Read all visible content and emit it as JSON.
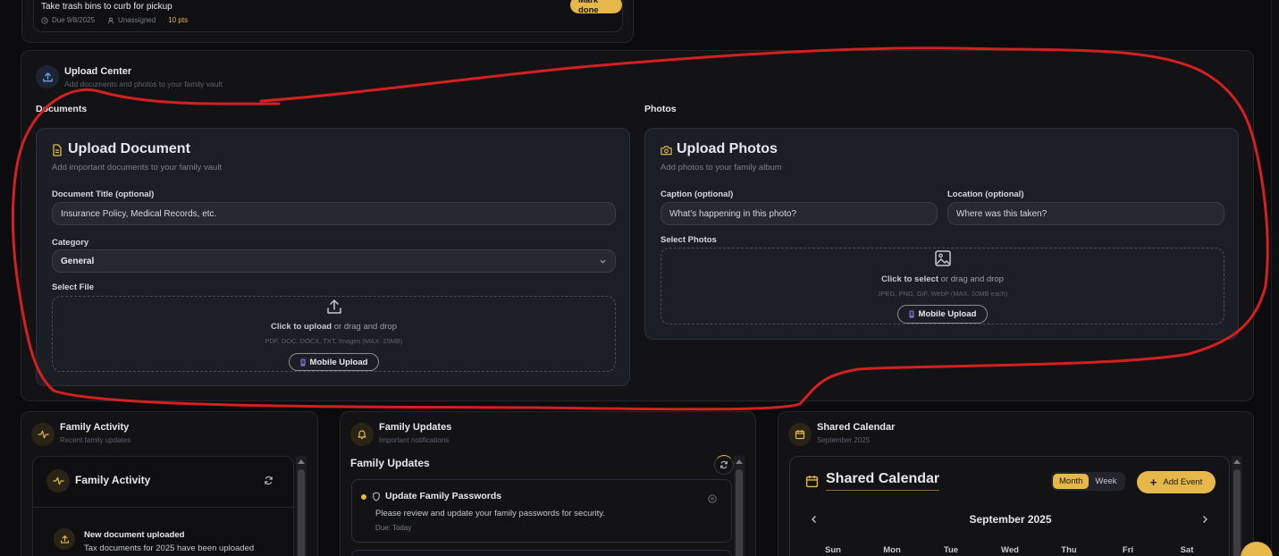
{
  "chores_card": {
    "chore_title": "Take trash bins to curb for pickup",
    "due": "Due 9/8/2025",
    "assignee": "Unassigned",
    "points": "10 pts",
    "mark_done_label": "Mark done"
  },
  "upload_center": {
    "title": "Upload Center",
    "subtitle": "Add documents and photos to your family vault",
    "documents": {
      "section_label": "Documents",
      "card_title": "Upload Document",
      "card_subtitle": "Add important documents to your family vault",
      "title_label": "Document Title (optional)",
      "title_placeholder": "Insurance Policy, Medical Records, etc.",
      "category_label": "Category",
      "category_value": "General",
      "file_label": "Select File",
      "drop_primary": "Click to upload",
      "drop_secondary": " or drag and drop",
      "drop_hint": "PDF, DOC, DOCX, TXT, Images (MAX. 25MB)",
      "mobile_upload_label": "Mobile Upload"
    },
    "photos": {
      "section_label": "Photos",
      "card_title": "Upload Photos",
      "card_subtitle": "Add photos to your family album",
      "caption_label": "Caption (optional)",
      "caption_placeholder": "What's happening in this photo?",
      "location_label": "Location (optional)",
      "location_placeholder": "Where was this taken?",
      "select_label": "Select Photos",
      "drop_primary": "Click to select",
      "drop_secondary": " or drag and drop",
      "drop_hint": "JPEG, PNG, GIF, WebP (MAX. 10MB each)",
      "mobile_upload_label": "Mobile Upload"
    }
  },
  "family_activity": {
    "title": "Family Activity",
    "subtitle": "Recent family updates",
    "inner_title": "Family Activity",
    "item_title": "New document uploaded",
    "item_desc": "Tax documents for 2025 have been uploaded"
  },
  "family_updates": {
    "title": "Family Updates",
    "subtitle": "Important notifications",
    "inner_title": "Family Updates",
    "item_title": "Update Family Passwords",
    "item_desc": "Please review and update your family passwords for security.",
    "item_due": "Due: Today"
  },
  "shared_calendar": {
    "title": "Shared Calendar",
    "subtitle": "September 2025",
    "inner_title": "Shared Calendar",
    "view_month": "Month",
    "view_week": "Week",
    "add_event_label": "Add Event",
    "month_label": "September 2025",
    "weekdays": [
      "Sun",
      "Mon",
      "Tue",
      "Wed",
      "Thu",
      "Fri",
      "Sat"
    ]
  },
  "colors": {
    "accent_yellow": "#e6b84a",
    "annotation_red": "#d42020",
    "background": "#0c0c0f"
  }
}
